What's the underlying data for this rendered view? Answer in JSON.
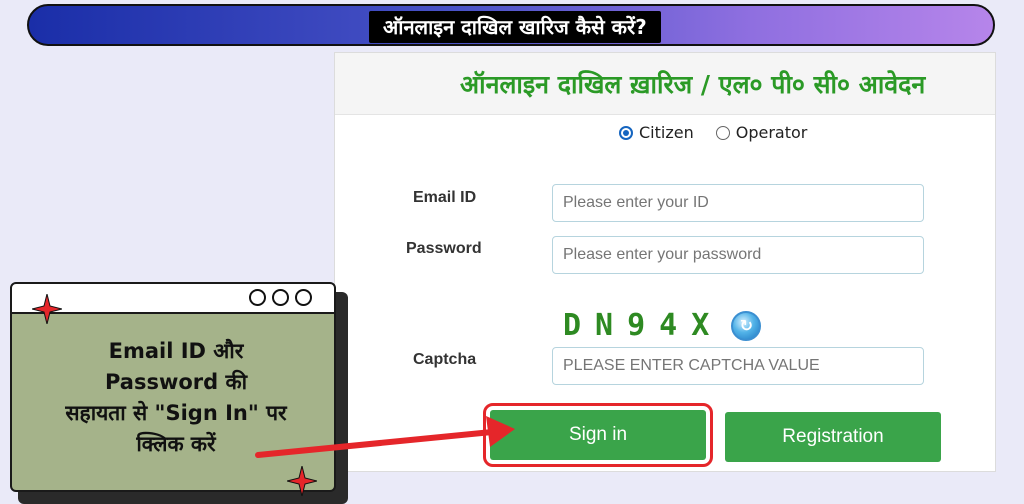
{
  "banner": {
    "title": "ऑनलाइन दाखिल खारिज कैसे करें?"
  },
  "form": {
    "title": "ऑनलाइन दाखिल ख़ारिज / एल० पी० सी० आवेदन",
    "user_type": {
      "options": [
        "Citizen",
        "Operator"
      ],
      "selected": "Citizen"
    },
    "email": {
      "label": "Email ID",
      "placeholder": "Please enter your ID"
    },
    "password": {
      "label": "Password",
      "placeholder": "Please enter your password"
    },
    "captcha": {
      "label": "Captcha",
      "code": "DN94X",
      "placeholder": "PLEASE ENTER CAPTCHA VALUE"
    },
    "buttons": {
      "signin": "Sign in",
      "registration": "Registration"
    }
  },
  "callout": {
    "lines": [
      "Email ID और",
      "Password की",
      "सहायता से \"Sign In\" पर",
      "क्लिक करें"
    ]
  },
  "colors": {
    "form_title": "#2b9a26",
    "button": "#3aa44a",
    "highlight": "#e5262a",
    "callout_bg": "#a5b38a"
  },
  "icons": [
    "refresh-captcha-icon",
    "sparkle-star-icon",
    "arrow-pointer-icon",
    "window-dot-icon"
  ]
}
